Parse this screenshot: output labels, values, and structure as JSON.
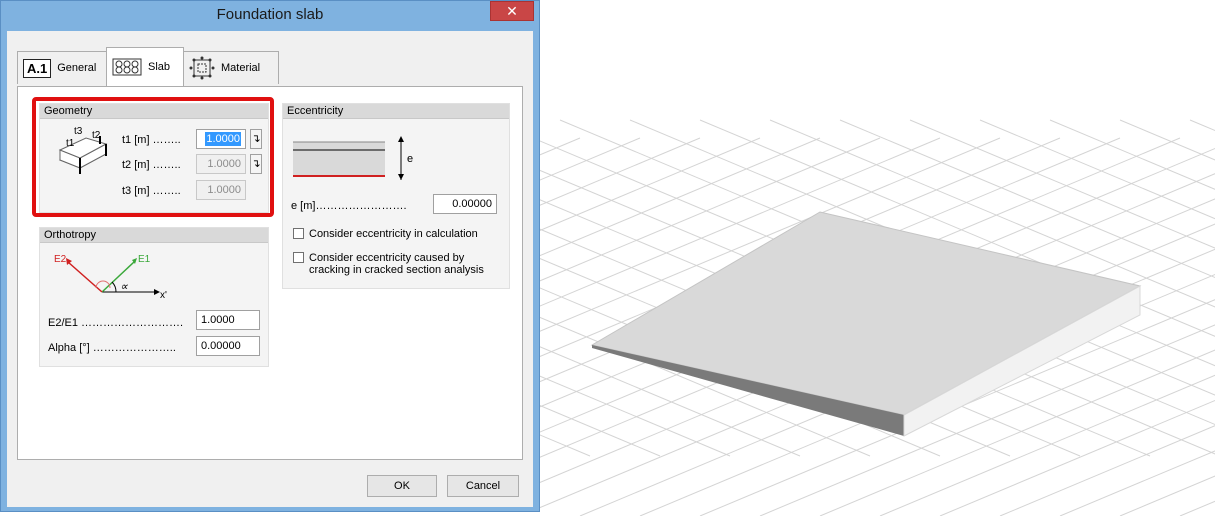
{
  "window": {
    "title": "Foundation slab",
    "close_glyph": "✕"
  },
  "tabs": [
    {
      "label": "General",
      "badge": "A.1"
    },
    {
      "label": "Slab"
    },
    {
      "label": "Material"
    }
  ],
  "geometry": {
    "header": "Geometry",
    "diagram_labels": {
      "t1": "t1",
      "t2": "t2",
      "t3": "t3"
    },
    "fields": [
      {
        "label": "t1 [m] ……..",
        "value": "1.0000"
      },
      {
        "label": "t2 [m] ……..",
        "value": "1.0000"
      },
      {
        "label": "t3 [m] ……..",
        "value": "1.0000"
      }
    ]
  },
  "orthotropy": {
    "header": "Orthotropy",
    "diagram_labels": {
      "e2": "E2",
      "e1": "E1",
      "alpha": "∝",
      "xprime": "x'"
    },
    "fields": [
      {
        "label": "E2/E1 ……………………….",
        "value": "1.0000"
      },
      {
        "label": "Alpha [°] …………………..",
        "value": "0.00000"
      }
    ]
  },
  "eccentricity": {
    "header": "Eccentricity",
    "diagram_label": "e",
    "field": {
      "label": "e [m]…………………….",
      "value": "0.00000"
    },
    "checkbox1": {
      "label": "Consider eccentricity in calculation",
      "checked": false
    },
    "checkbox2": {
      "label_line1": "Consider eccentricity caused by",
      "label_line2": "cracking in cracked section analysis",
      "checked": false
    }
  },
  "buttons": {
    "ok": "OK",
    "cancel": "Cancel"
  },
  "colors": {
    "titlebar": "#7fb2e0",
    "close": "#c94646",
    "highlight": "#e01010",
    "selection": "#3399ff",
    "slab_top": "#d9d9d9"
  }
}
